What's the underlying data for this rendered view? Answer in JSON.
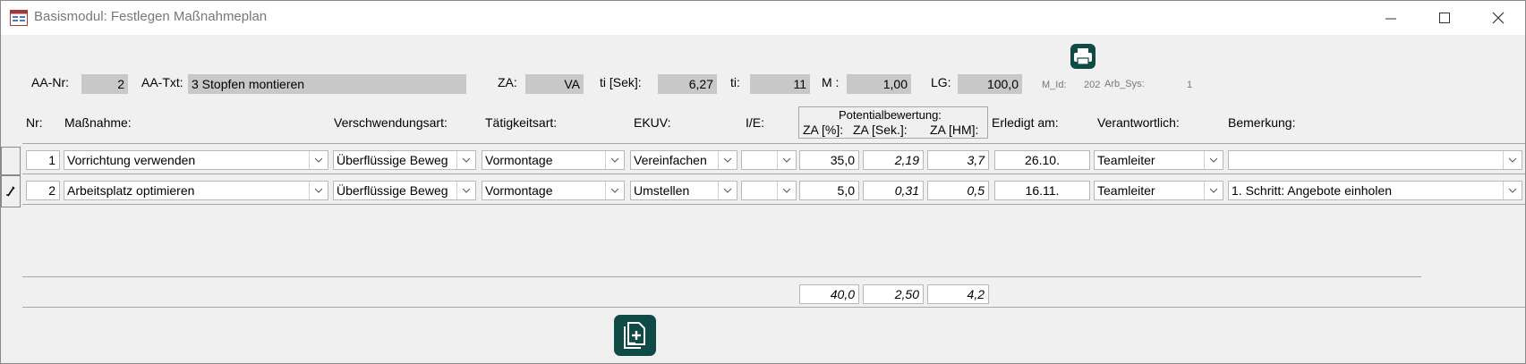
{
  "window": {
    "title": "Basismodul: Festlegen Maßnahmeplan",
    "icon": "access-form-icon",
    "controls": [
      "minimize",
      "maximize",
      "close"
    ]
  },
  "header": {
    "aa_nr_label": "AA-Nr:",
    "aa_nr": "2",
    "aa_txt_label": "AA-Txt:",
    "aa_txt": "3 Stopfen montieren",
    "za_label": "ZA:",
    "za": "VA",
    "ti_sek_label": "ti [Sek]:",
    "ti_sek": "6,27",
    "ti_label": "ti:",
    "ti": "11",
    "m_label": "M :",
    "m": "1,00",
    "lg_label": "LG:",
    "lg": "100,0",
    "m_id_label": "M_Id:",
    "m_id": "202",
    "arb_sys_label": "Arb_Sys:",
    "arb_sys": "1",
    "print_icon": "printer-icon"
  },
  "columns": {
    "nr": "Nr:",
    "massnahme": "Maßnahme:",
    "verschwendungsart": "Verschwendungsart:",
    "taetigkeitsart": "Tätigkeitsart:",
    "ekuv": "EKUV:",
    "ie": "I/E:",
    "potential_title": "Potentialbewertung:",
    "za_pct": "ZA [%]:",
    "za_sek": "ZA [Sek.]:",
    "za_hm": "ZA [HM]:",
    "erledigt": "Erledigt am:",
    "verantwortlich": "Verantwortlich:",
    "bemerkung": "Bemerkung:"
  },
  "rows": [
    {
      "selector_icon": "",
      "nr": "1",
      "massnahme": "Vorrichtung verwenden",
      "verschwendungsart": "Überflüssige Beweg",
      "taetigkeitsart": "Vormontage",
      "ekuv": "Vereinfachen",
      "ie": "",
      "za_pct": "35,0",
      "za_sek": "2,19",
      "za_hm": "3,7",
      "erledigt": "26.10.",
      "verantwortlich": "Teamleiter",
      "bemerkung": ""
    },
    {
      "selector_icon": "pencil-edit-icon",
      "nr": "2",
      "massnahme": "Arbeitsplatz optimieren",
      "verschwendungsart": "Überflüssige Beweg",
      "taetigkeitsart": "Vormontage",
      "ekuv": "Umstellen",
      "ie": "",
      "za_pct": "5,0",
      "za_sek": "0,31",
      "za_hm": "0,5",
      "erledigt": "16.11.",
      "verantwortlich": "Teamleiter",
      "bemerkung": "1. Schritt: Angebote einholen"
    }
  ],
  "totals": {
    "za_pct": "40,0",
    "za_sek": "2,50",
    "za_hm": "4,2"
  },
  "footer": {
    "add_icon": "add-document-icon"
  },
  "colors": {
    "form_bg": "#f0f0f0",
    "readonly_bg": "#c8c8c8",
    "button_dark": "#0f4a47"
  }
}
